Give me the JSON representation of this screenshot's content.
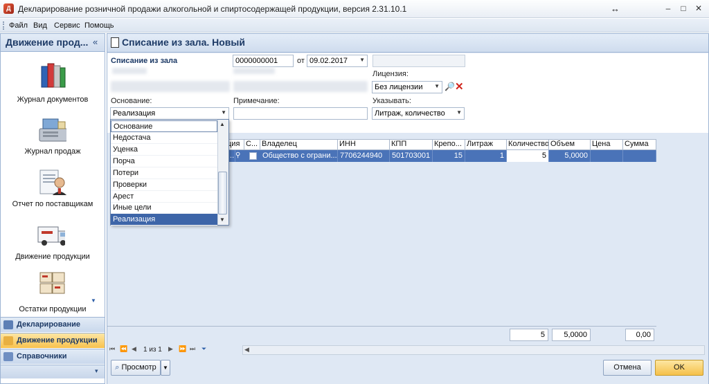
{
  "window": {
    "title": "Декларирование розничной продажи алкогольной и спиртосодержащей продукции, версия 2.31.10.1",
    "controls": [
      "↔",
      "–",
      "□",
      "✕"
    ]
  },
  "menu": [
    "Файл",
    "Вид",
    "Сервис",
    "Помощь"
  ],
  "nav": {
    "title": "Движение прод...",
    "collapse": "«",
    "tiles": [
      "Журнал документов",
      "Журнал продаж",
      "Отчет по поставщикам",
      "Движение продукции",
      "Остатки продукции"
    ],
    "sections": [
      {
        "label": "Декларирование",
        "active": false
      },
      {
        "label": "Движение продукции",
        "active": true
      },
      {
        "label": "Справочники",
        "active": false
      }
    ],
    "chevron": "▾"
  },
  "doc": {
    "title": "Списание из зала. Новый",
    "form": {
      "label": "Списание из зала",
      "number": "0000000001",
      "from_label": "от",
      "date": "09.02.2017",
      "license_label": "Лицензия:",
      "license_value": "Без лицензии",
      "reason_label": "Основание:",
      "reason_value": "Реализация",
      "note_label": "Примечание:",
      "note_value": "",
      "specify_label": "Указывать:",
      "specify_value": "Литраж, количество"
    },
    "grid": {
      "columns": [
        "",
        "ция",
        "С...",
        "Владелец",
        "ИНН",
        "КПП",
        "Крепо...",
        "Литраж",
        "Количество",
        "Объем",
        "Цена",
        "Сумма"
      ],
      "row": {
        "code": "...",
        "owner": "Общество с ограни...",
        "inn": "7706244940",
        "kpp": "501703001",
        "strength": "15",
        "litre": "1",
        "qty": "5",
        "volume": "5,0000",
        "price": "",
        "sum": ""
      }
    },
    "totals": {
      "qty": "5",
      "volume": "5,0000",
      "sum": "0,00"
    },
    "pager": {
      "text": "1 из 1"
    },
    "buttons": {
      "preview": "Просмотр",
      "cancel": "Отмена",
      "ok": "OK"
    }
  },
  "dropdown": {
    "items": [
      "Основание",
      "Недостача",
      "Уценка",
      "Порча",
      "Потери",
      "Проверки",
      "Арест",
      "Иные цели",
      "Реализация"
    ],
    "selected": "Реализация"
  }
}
